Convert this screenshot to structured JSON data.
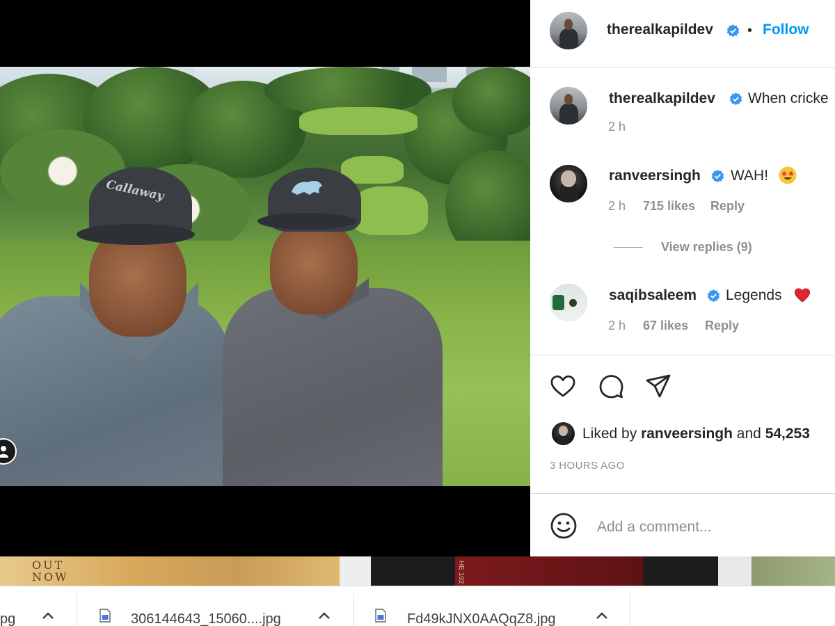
{
  "post": {
    "author": "therealkapildev",
    "follow_label": "Follow",
    "separator": "•",
    "caption_author": "therealkapildev",
    "caption_text": "When cricke",
    "caption_time": "2 h",
    "photo_cap_logo": "Callaway",
    "liked_by_prefix": "Liked by",
    "liked_by_user": "ranveersingh",
    "liked_by_suffix": "and",
    "liked_count": "54,253",
    "time_ago": "3 HOURS AGO",
    "comment_placeholder": "Add a comment..."
  },
  "comments": [
    {
      "username": "ranveersingh",
      "text": "WAH!",
      "emoji": "star-struck-emoji",
      "time": "2 h",
      "likes": "715 likes",
      "reply": "Reply"
    },
    {
      "username": "saqibsaleem",
      "text": "Legends",
      "emoji": "red-heart-emoji",
      "time": "2 h",
      "likes": "67 likes",
      "reply": "Reply"
    }
  ],
  "view_replies": "View replies (9)",
  "background_strip": {
    "left_text": "OUT\nNOW",
    "red_text": "HE 192"
  },
  "downloads": [
    {
      "name": "pg"
    },
    {
      "name": "306144643_15060....jpg"
    },
    {
      "name": "Fd49kJNX0AAQqZ8.jpg"
    }
  ],
  "colors": {
    "accent": "#0095f6",
    "verified": "#3897f0",
    "text": "#262626",
    "muted": "#8e8e8e",
    "heart": "#ed4956"
  }
}
